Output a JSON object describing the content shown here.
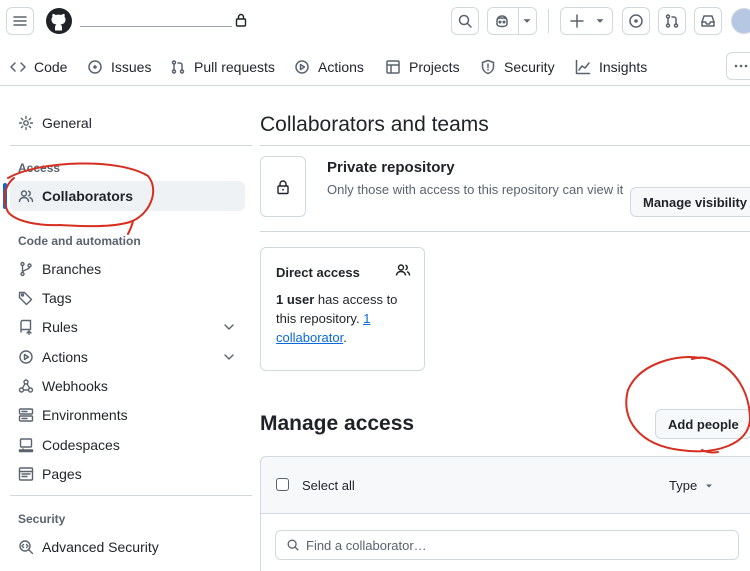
{
  "repo_nav": {
    "code": "Code",
    "issues": "Issues",
    "pull_requests": "Pull requests",
    "actions": "Actions",
    "projects": "Projects",
    "security": "Security",
    "insights": "Insights"
  },
  "sidebar": {
    "general": "General",
    "access_heading": "Access",
    "collaborators": "Collaborators",
    "code_automation_heading": "Code and automation",
    "branches": "Branches",
    "tags": "Tags",
    "rules": "Rules",
    "actions": "Actions",
    "webhooks": "Webhooks",
    "environments": "Environments",
    "codespaces": "Codespaces",
    "pages": "Pages",
    "security_heading": "Security",
    "advanced_security": "Advanced Security"
  },
  "main": {
    "title": "Collaborators and teams",
    "private_title": "Private repository",
    "private_desc": "Only those with access to this repository can view it",
    "manage_visibility": "Manage visibility",
    "direct_access_title": "Direct access",
    "direct_access_count": "1 user",
    "direct_access_text": " has access to this repository. ",
    "direct_access_link": "1 collaborator",
    "direct_access_end": ".",
    "manage_access_title": "Manage access",
    "add_people": "Add people",
    "select_all": "Select all",
    "type_label": "Type",
    "search_placeholder": "Find a collaborator…"
  },
  "colors": {
    "accent": "#0969da",
    "annotation": "#d62e1f"
  }
}
